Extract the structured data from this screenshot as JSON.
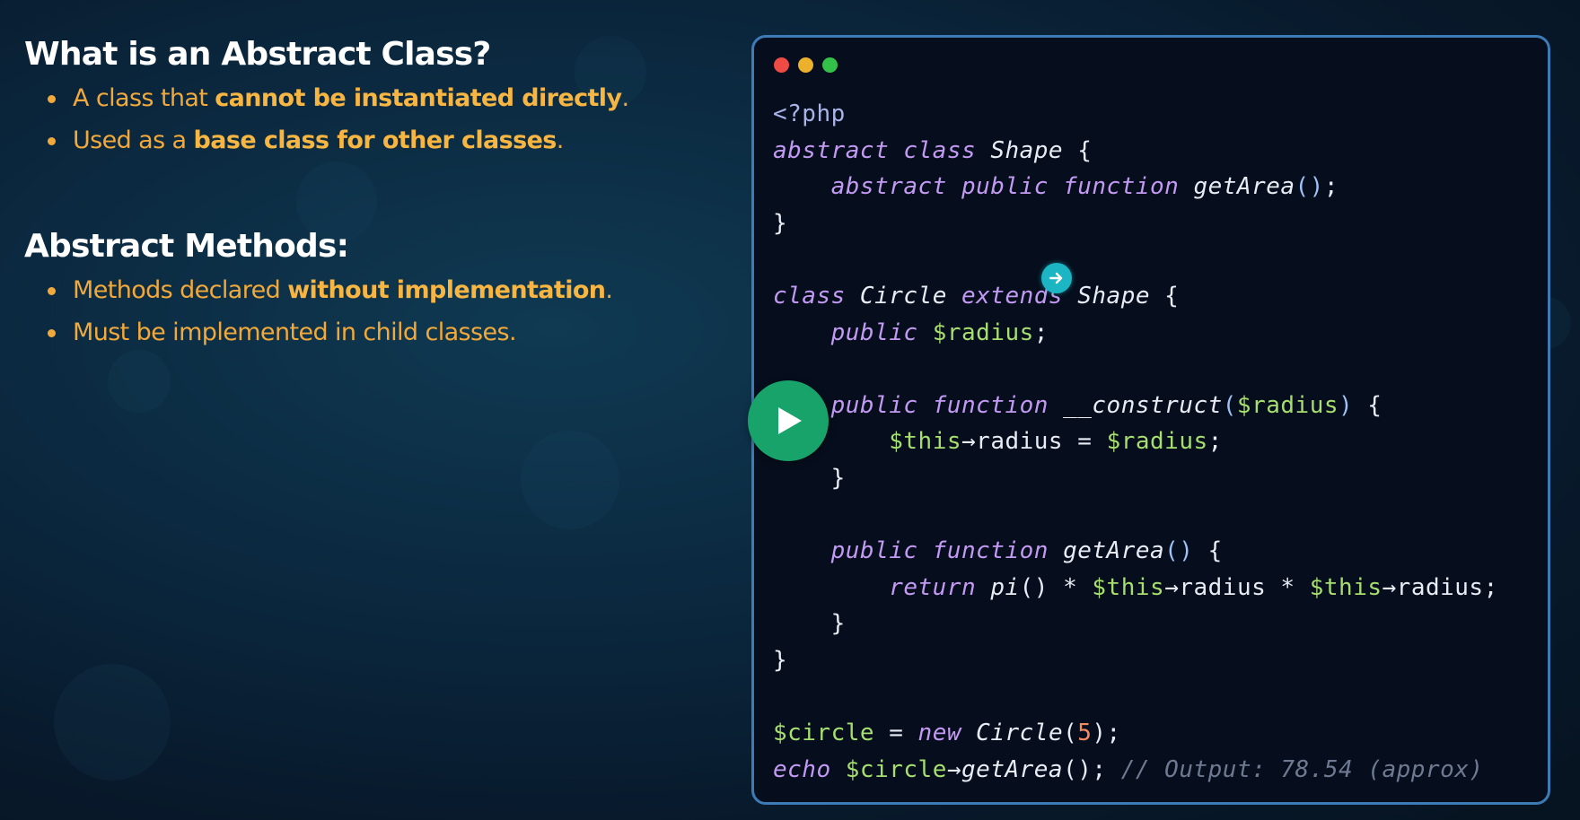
{
  "sections": [
    {
      "title": "What is an Abstract Class?",
      "bullets": [
        {
          "plain1": "A class that ",
          "bold": "cannot be instantiated directly",
          "plain2": "."
        },
        {
          "plain1": "Used as a ",
          "bold": "base class for other classes",
          "plain2": "."
        }
      ]
    },
    {
      "title": "Abstract Methods:",
      "bullets": [
        {
          "plain1": "Methods declared ",
          "bold": "without implementation",
          "plain2": "."
        },
        {
          "plain1": "Must be implemented in child classes.",
          "bold": "",
          "plain2": ""
        }
      ]
    }
  ],
  "code_window": {
    "language": "php",
    "window_controls": [
      "close",
      "minimize",
      "maximize"
    ],
    "lines": [
      [
        {
          "t": "<?php",
          "c": "tag"
        }
      ],
      [
        {
          "t": "abstract class ",
          "c": "kw"
        },
        {
          "t": "Shape",
          "c": "cls"
        },
        {
          "t": " {",
          "c": "punc"
        }
      ],
      [
        {
          "t": "    abstract public function ",
          "c": "kw"
        },
        {
          "t": "getArea",
          "c": "fn"
        },
        {
          "t": "()",
          "c": "paren"
        },
        {
          "t": ";",
          "c": "punc"
        }
      ],
      [
        {
          "t": "}",
          "c": "punc"
        }
      ],
      [],
      [
        {
          "t": "class ",
          "c": "kw"
        },
        {
          "t": "Circle ",
          "c": "cls"
        },
        {
          "t": "extends ",
          "c": "kw"
        },
        {
          "t": "Shape",
          "c": "cls"
        },
        {
          "t": " {",
          "c": "punc"
        }
      ],
      [
        {
          "t": "    public ",
          "c": "kw"
        },
        {
          "t": "$radius",
          "c": "var"
        },
        {
          "t": ";",
          "c": "punc"
        }
      ],
      [],
      [
        {
          "t": "    public function ",
          "c": "kw"
        },
        {
          "t": "__construct",
          "c": "fn"
        },
        {
          "t": "(",
          "c": "paren"
        },
        {
          "t": "$radius",
          "c": "var"
        },
        {
          "t": ")",
          "c": "paren"
        },
        {
          "t": " {",
          "c": "punc"
        }
      ],
      [
        {
          "t": "        ",
          "c": "punc"
        },
        {
          "t": "$this",
          "c": "var"
        },
        {
          "t": "→radius = ",
          "c": "punc"
        },
        {
          "t": "$radius",
          "c": "var"
        },
        {
          "t": ";",
          "c": "punc"
        }
      ],
      [
        {
          "t": "    }",
          "c": "punc"
        }
      ],
      [],
      [
        {
          "t": "    public function ",
          "c": "kw"
        },
        {
          "t": "getArea",
          "c": "fn"
        },
        {
          "t": "()",
          "c": "paren"
        },
        {
          "t": " {",
          "c": "punc"
        }
      ],
      [
        {
          "t": "        return ",
          "c": "kw"
        },
        {
          "t": "pi",
          "c": "fn"
        },
        {
          "t": "() * ",
          "c": "punc"
        },
        {
          "t": "$this",
          "c": "var"
        },
        {
          "t": "→radius * ",
          "c": "punc"
        },
        {
          "t": "$this",
          "c": "var"
        },
        {
          "t": "→radius;",
          "c": "punc"
        }
      ],
      [
        {
          "t": "    }",
          "c": "punc"
        }
      ],
      [
        {
          "t": "}",
          "c": "punc"
        }
      ],
      [],
      [
        {
          "t": "$circle",
          "c": "var"
        },
        {
          "t": " = ",
          "c": "punc"
        },
        {
          "t": "new ",
          "c": "kw"
        },
        {
          "t": "Circle",
          "c": "cls"
        },
        {
          "t": "(",
          "c": "punc"
        },
        {
          "t": "5",
          "c": "num"
        },
        {
          "t": ");",
          "c": "punc"
        }
      ],
      [
        {
          "t": "echo ",
          "c": "kw"
        },
        {
          "t": "$circle",
          "c": "var"
        },
        {
          "t": "→",
          "c": "punc"
        },
        {
          "t": "getArea",
          "c": "fn"
        },
        {
          "t": "(); ",
          "c": "punc"
        },
        {
          "t": "// Output: 78.54 (approx)",
          "c": "cmt"
        }
      ]
    ]
  },
  "icons": {
    "play": "play-icon",
    "cursor": "cursor-arrow-icon"
  },
  "colors": {
    "accent_text": "#f2a93b",
    "code_border": "#3c7bb6",
    "play_button": "#17a36a",
    "keyword": "#c39af3",
    "variable": "#a6de6f",
    "number": "#f38b5f",
    "comment": "#6e7a91"
  }
}
